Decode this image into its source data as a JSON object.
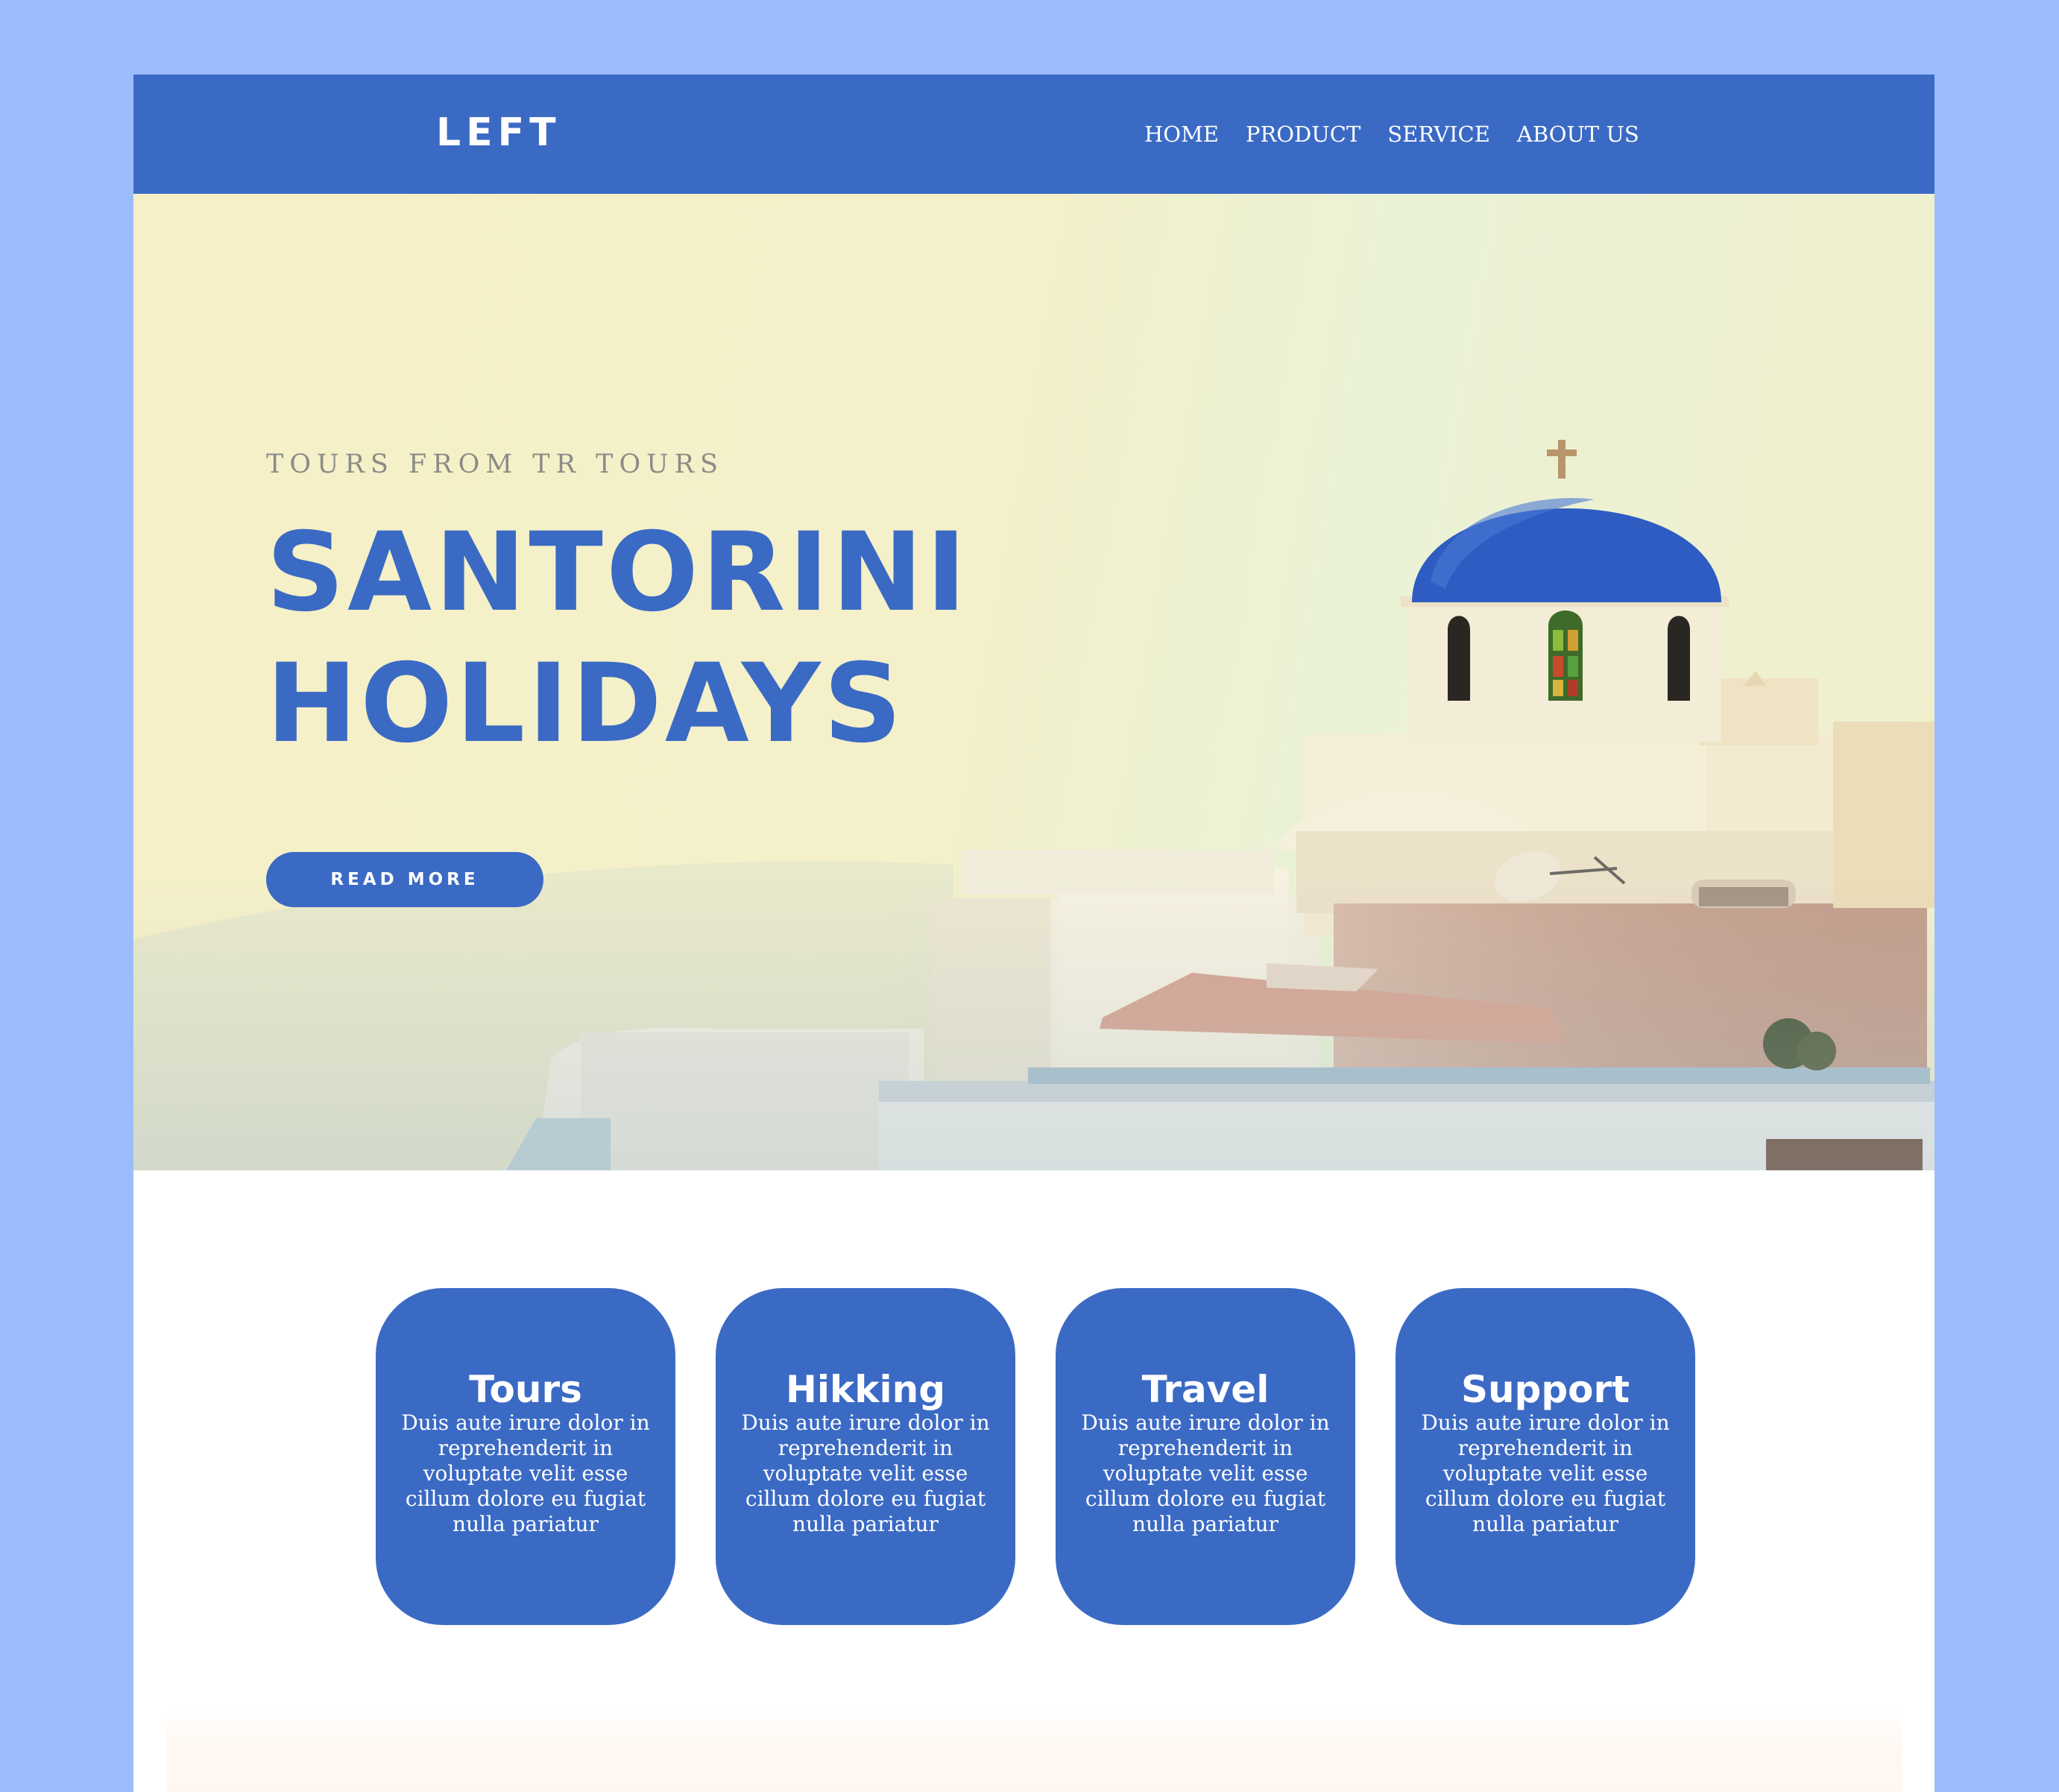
{
  "header": {
    "logo": "LEFT",
    "nav": [
      {
        "label": "HOME"
      },
      {
        "label": "PRODUCT"
      },
      {
        "label": "SERVICE"
      },
      {
        "label": "ABOUT US"
      }
    ]
  },
  "hero": {
    "kicker": "TOURS FROM TR TOURS",
    "title_line1": "SANTORINI",
    "title_line2": "HOLIDAYS",
    "button_label": "READ MORE",
    "image_subject": "santorini-blue-dome-church"
  },
  "features": [
    {
      "title": "Tours",
      "text": "Duis aute irure dolor in reprehenderit in voluptate velit esse cillum dolore eu fugiat nulla pariatur"
    },
    {
      "title": "Hikking",
      "text": "Duis aute irure dolor in reprehenderit in voluptate velit esse cillum dolore eu fugiat nulla pariatur"
    },
    {
      "title": "Travel",
      "text": "Duis aute irure dolor in reprehenderit in voluptate velit esse cillum dolore eu fugiat nulla pariatur"
    },
    {
      "title": "Support",
      "text": "Duis aute irure dolor in reprehenderit in voluptate velit esse cillum dolore eu fugiat nulla pariatur"
    }
  ],
  "colors": {
    "brand": "#3b6ac4",
    "outer_background": "#9bbdfe",
    "hero_background": "#f5f0c8",
    "kicker_text": "#8b8b86"
  }
}
